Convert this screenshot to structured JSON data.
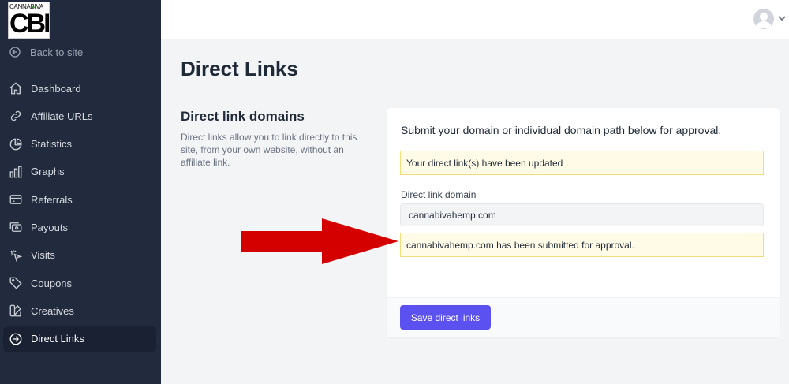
{
  "logo": {
    "top_text": "CANNABIVA",
    "bottom_text": "CBD"
  },
  "sidebar": {
    "back_label": "Back to site",
    "items": [
      {
        "label": "Dashboard",
        "icon": "home-icon"
      },
      {
        "label": "Affiliate URLs",
        "icon": "link-icon"
      },
      {
        "label": "Statistics",
        "icon": "pie-chart-icon"
      },
      {
        "label": "Graphs",
        "icon": "bar-chart-icon"
      },
      {
        "label": "Referrals",
        "icon": "credit-card-icon"
      },
      {
        "label": "Payouts",
        "icon": "cash-icon"
      },
      {
        "label": "Visits",
        "icon": "cursor-click-icon"
      },
      {
        "label": "Coupons",
        "icon": "tag-icon"
      },
      {
        "label": "Creatives",
        "icon": "color-swatch-icon"
      },
      {
        "label": "Direct Links",
        "icon": "arrow-circle-right-icon",
        "active": true
      }
    ]
  },
  "header": {
    "avatar": "user-avatar-icon",
    "menu": "chevron-down-icon"
  },
  "main": {
    "title": "Direct Links",
    "section_title": "Direct link domains",
    "section_desc": "Direct links allow you to link directly to this site, from your own website, without an affiliate link."
  },
  "card": {
    "heading": "Submit your domain or individual domain path below for approval.",
    "alert_top": "Your direct link(s) have been updated",
    "field_label": "Direct link domain",
    "field_value": "cannabivahemp.com",
    "alert_bottom": "cannabivahemp.com has been submitted for approval.",
    "save_label": "Save direct links"
  },
  "colors": {
    "sidebar_bg": "#222b3d",
    "accent": "#5b50f0",
    "alert_bg": "#fffbe6",
    "alert_border": "#f5dc7a",
    "arrow": "#d40000"
  }
}
